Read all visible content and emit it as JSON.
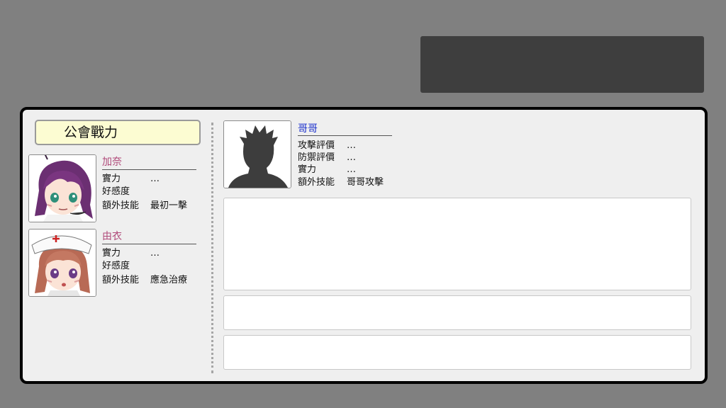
{
  "guild_title": "公會戰力",
  "members": [
    {
      "name": "加奈",
      "stats": [
        {
          "label": "實力",
          "value": "…"
        },
        {
          "label": "好感度",
          "value": ""
        },
        {
          "label": "額外技能",
          "value": "最初一擊"
        }
      ]
    },
    {
      "name": "由衣",
      "stats": [
        {
          "label": "實力",
          "value": "…"
        },
        {
          "label": "好感度",
          "value": ""
        },
        {
          "label": "額外技能",
          "value": "應急治療"
        }
      ]
    }
  ],
  "player": {
    "name": "哥哥",
    "stats": [
      {
        "label": "攻擊評價",
        "value": "…"
      },
      {
        "label": "防禦評價",
        "value": "…"
      },
      {
        "label": "實力",
        "value": "…"
      },
      {
        "label": "額外技能",
        "value": "哥哥攻擊"
      }
    ]
  },
  "colors": {
    "background": "#808080",
    "panel": "#efefef",
    "title_plate": "#fcfcd2",
    "member_name": "#b04a7a",
    "player_name": "#1a2fcc",
    "top_box": "#3e3e3e"
  }
}
